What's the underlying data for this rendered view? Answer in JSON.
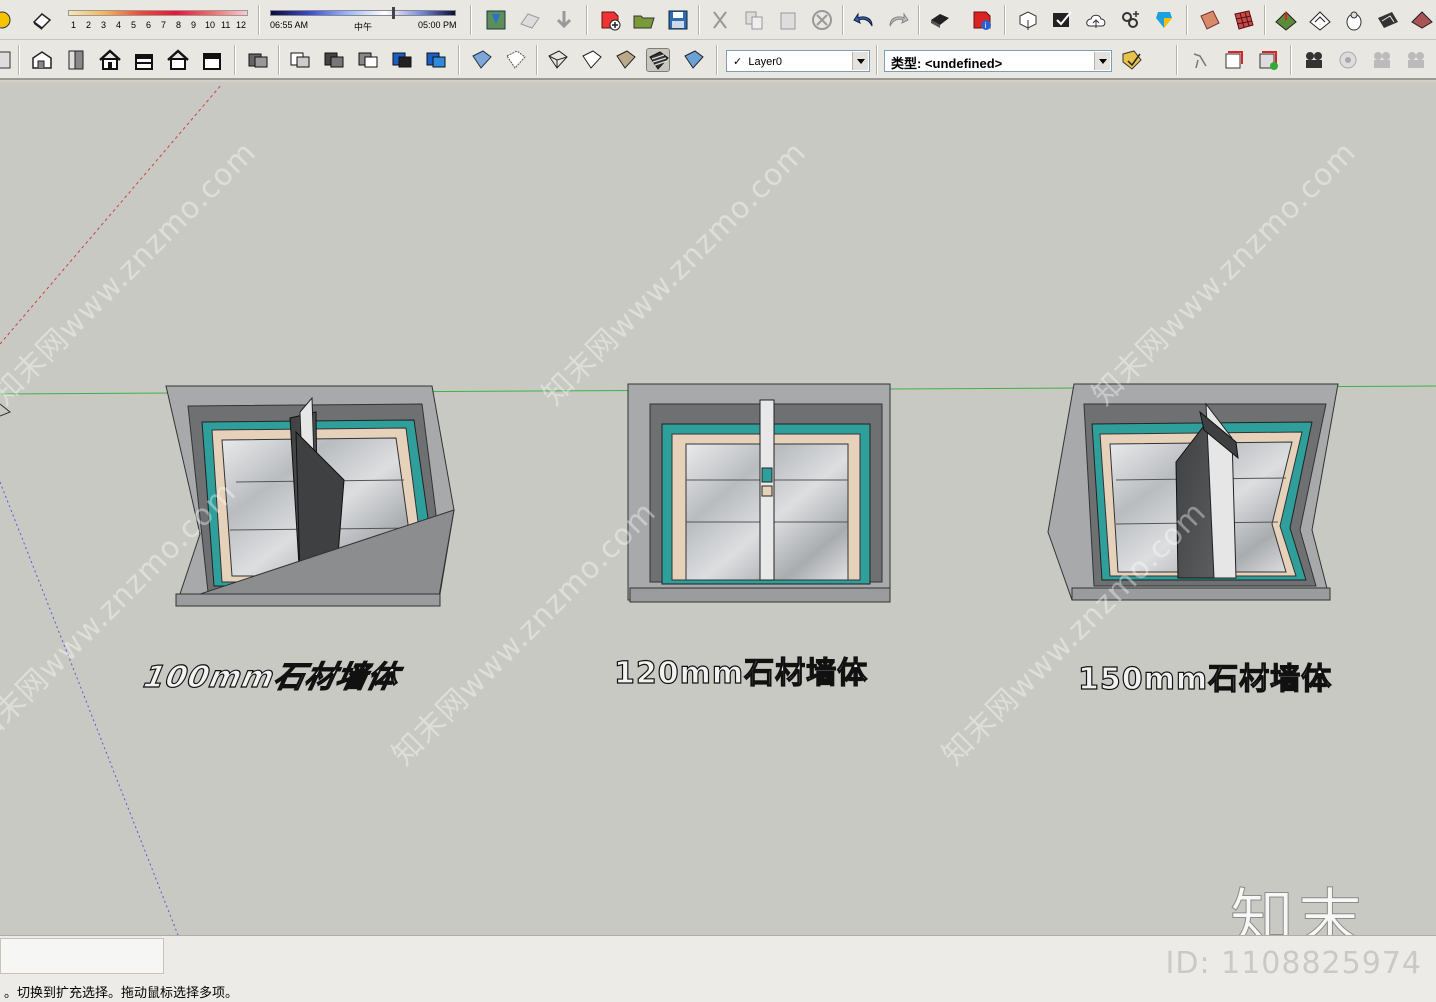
{
  "shadow": {
    "months": [
      "1",
      "2",
      "3",
      "4",
      "5",
      "6",
      "7",
      "8",
      "9",
      "10",
      "11",
      "12"
    ],
    "time_start": "06:55 AM",
    "time_noon": "中午",
    "time_end": "05:00 PM"
  },
  "layer_dropdown": {
    "check": "✓",
    "value": "Layer0"
  },
  "type_dropdown": {
    "value": "类型: <undefined>"
  },
  "models": [
    {
      "label": "100mm石材墙体"
    },
    {
      "label": "120mm石材墙体"
    },
    {
      "label": "150mm石材墙体"
    }
  ],
  "watermark_text": "知末网www.znzmo.com",
  "brand": {
    "logo": "知末",
    "id": "ID: 1108825974"
  },
  "status": {
    "text": "。切换到扩充选择。拖动鼠标选择多项。"
  },
  "colors": {
    "viewport": "#c9c9c3",
    "teal": "#2f9f9b",
    "beige": "#e6d2bb",
    "stone_frame": "#a3a5a7",
    "dark_panel": "#4d4f50",
    "horizon": "#3cb34a"
  }
}
